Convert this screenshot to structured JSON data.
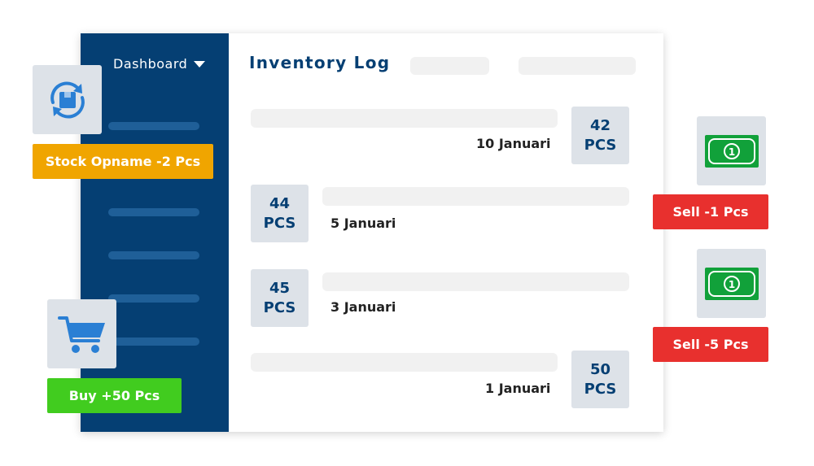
{
  "sidebar": {
    "dashboard_label": "Dashboard"
  },
  "main": {
    "title": "Inventory Log",
    "entries": [
      {
        "qty": "42",
        "unit": "PCS",
        "date": "10 Januari"
      },
      {
        "qty": "44",
        "unit": "PCS",
        "date": "5 Januari"
      },
      {
        "qty": "45",
        "unit": "PCS",
        "date": "3 Januari"
      },
      {
        "qty": "50",
        "unit": "PCS",
        "date": "1 Januari"
      }
    ]
  },
  "events": {
    "stock_opname": "Stock Opname -2 Pcs",
    "buy": "Buy +50 Pcs",
    "sell_1": "Sell -1 Pcs",
    "sell_2": "Sell -5 Pcs"
  },
  "icons": {
    "stock_opname": "box-sync-icon",
    "buy": "shopping-cart-icon",
    "sell": "banknote-icon"
  },
  "colors": {
    "sidebar": "#053f73",
    "accent_blue": "#2a7fd4",
    "stock_opname": "#f0a500",
    "buy": "#41cc1f",
    "sell": "#e8302e",
    "banknote": "#11a13a"
  }
}
